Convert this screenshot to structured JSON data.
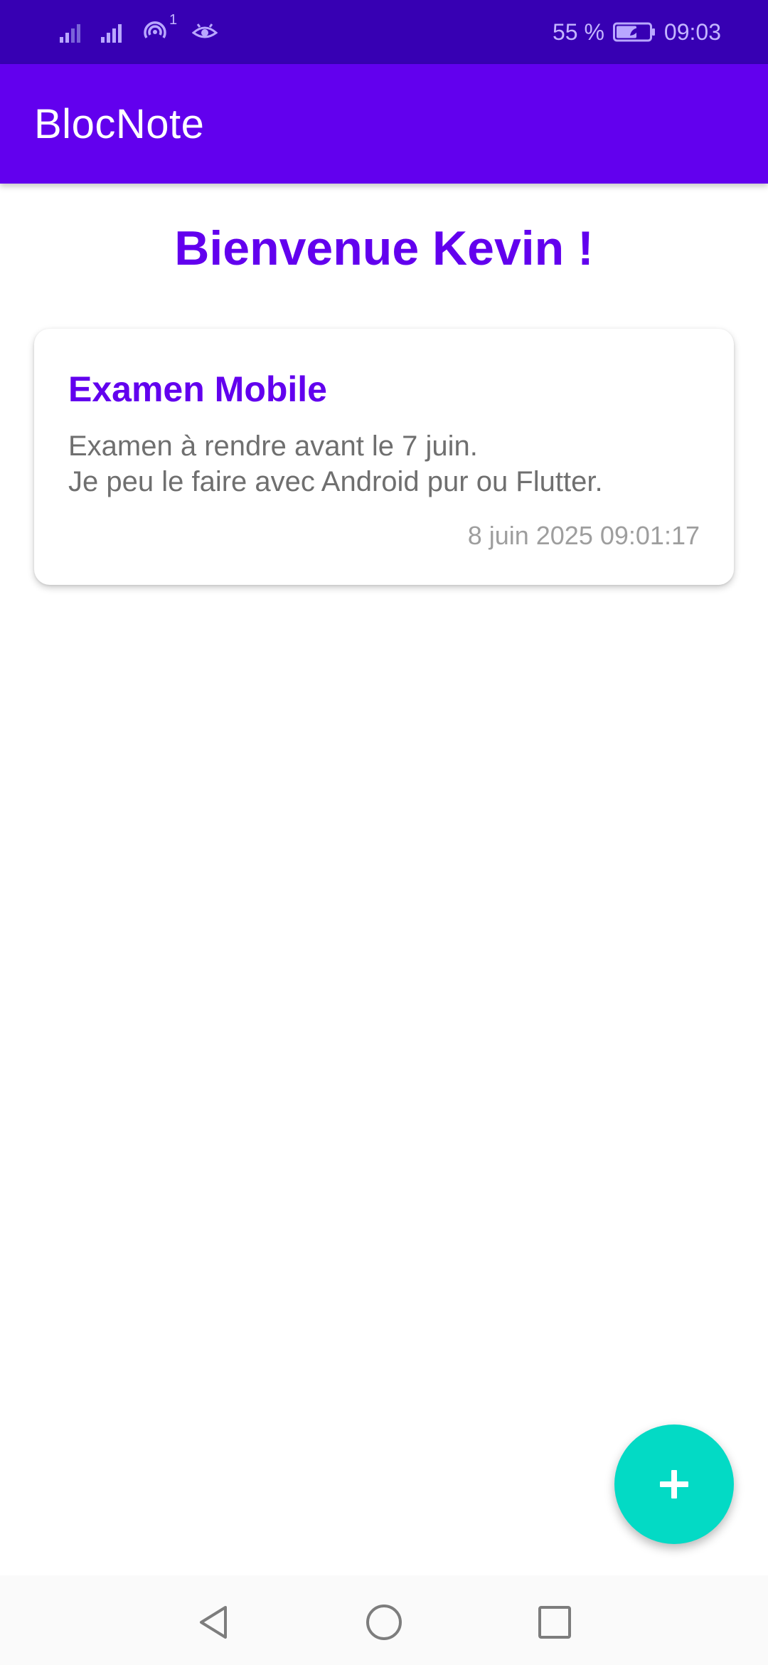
{
  "status_bar": {
    "battery_text": "55 %",
    "time": "09:03",
    "hotspot_badge": "1",
    "icons": [
      "signal-1-icon",
      "signal-2-icon",
      "hotspot-icon",
      "eye-icon",
      "battery-icon"
    ]
  },
  "app_bar": {
    "title": "BlocNote"
  },
  "welcome": {
    "text": "Bienvenue Kevin !"
  },
  "notes": [
    {
      "title": "Examen Mobile",
      "body": "Examen à rendre avant le 7 juin.\nJe peu le faire avec Android pur ou Flutter.",
      "date": "8 juin 2025 09:01:17"
    }
  ],
  "fab": {
    "icon": "plus-icon"
  },
  "nav_bar": {
    "icons": [
      "back-icon",
      "home-icon",
      "recents-icon"
    ]
  },
  "colors": {
    "primary": "#6200EE",
    "primary_dark": "#3700B3",
    "accent": "#03DAC5"
  }
}
